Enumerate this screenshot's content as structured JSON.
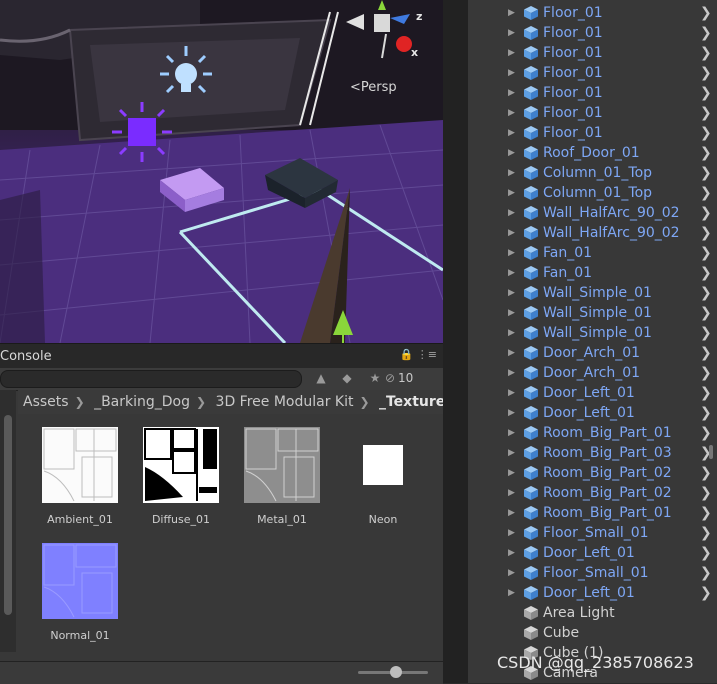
{
  "scene": {
    "projection_label": "Persp",
    "gizmo_axes": {
      "z": "z",
      "x": "x"
    }
  },
  "console": {
    "tab_title": "Console",
    "hidden_count": "10",
    "lock_icon": "lock-icon",
    "menu_icon": "panel-menu-icon"
  },
  "breadcrumb": {
    "items": [
      "Assets",
      "_Barking_Dog",
      "3D Free Modular Kit",
      "_Texture"
    ]
  },
  "assets": [
    {
      "name": "Ambient_01",
      "kind": "ambient"
    },
    {
      "name": "Diffuse_01",
      "kind": "diffuse"
    },
    {
      "name": "Metal_01",
      "kind": "metal"
    },
    {
      "name": "Neon",
      "kind": "neon"
    },
    {
      "name": "Normal_01",
      "kind": "normal"
    }
  ],
  "hierarchy": {
    "items": [
      {
        "label": "Floor_01",
        "prefab": true
      },
      {
        "label": "Floor_01",
        "prefab": true
      },
      {
        "label": "Floor_01",
        "prefab": true
      },
      {
        "label": "Floor_01",
        "prefab": true
      },
      {
        "label": "Floor_01",
        "prefab": true
      },
      {
        "label": "Floor_01",
        "prefab": true
      },
      {
        "label": "Floor_01",
        "prefab": true
      },
      {
        "label": "Roof_Door_01",
        "prefab": true
      },
      {
        "label": "Column_01_Top",
        "prefab": true
      },
      {
        "label": "Column_01_Top",
        "prefab": true
      },
      {
        "label": "Wall_HalfArc_90_02",
        "prefab": true
      },
      {
        "label": "Wall_HalfArc_90_02",
        "prefab": true
      },
      {
        "label": "Fan_01",
        "prefab": true
      },
      {
        "label": "Fan_01",
        "prefab": true
      },
      {
        "label": "Wall_Simple_01",
        "prefab": true
      },
      {
        "label": "Wall_Simple_01",
        "prefab": true
      },
      {
        "label": "Wall_Simple_01",
        "prefab": true
      },
      {
        "label": "Door_Arch_01",
        "prefab": true
      },
      {
        "label": "Door_Arch_01",
        "prefab": true
      },
      {
        "label": "Door_Left_01",
        "prefab": true
      },
      {
        "label": "Door_Left_01",
        "prefab": true
      },
      {
        "label": "Room_Big_Part_01",
        "prefab": true
      },
      {
        "label": "Room_Big_Part_03",
        "prefab": true
      },
      {
        "label": "Room_Big_Part_02",
        "prefab": true
      },
      {
        "label": "Room_Big_Part_02",
        "prefab": true
      },
      {
        "label": "Room_Big_Part_01",
        "prefab": true
      },
      {
        "label": "Floor_Small_01",
        "prefab": true
      },
      {
        "label": "Door_Left_01",
        "prefab": true
      },
      {
        "label": "Floor_Small_01",
        "prefab": true
      },
      {
        "label": "Door_Left_01",
        "prefab": true
      },
      {
        "label": "Area Light",
        "prefab": false
      },
      {
        "label": "Cube",
        "prefab": false
      },
      {
        "label": "Cube (1)",
        "prefab": false
      },
      {
        "label": "Camera",
        "prefab": false
      }
    ]
  },
  "watermark": "CSDN @qq_2385708623",
  "colors": {
    "prefab_label": "#7ea7f5",
    "prefab_cube": "#6aa8e8",
    "panel_bg": "#383838",
    "scene_purple": "#4a2f7a"
  }
}
